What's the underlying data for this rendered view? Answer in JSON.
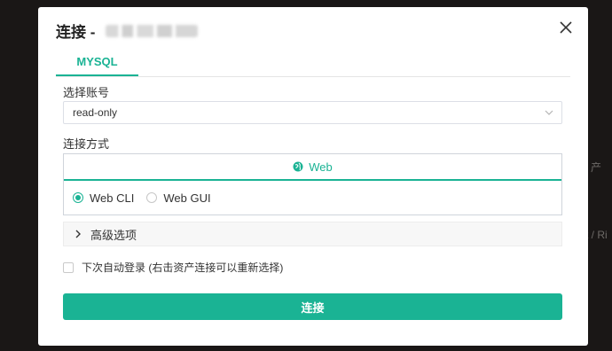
{
  "background": {
    "side_texts": [
      "产",
      "t / Ri"
    ]
  },
  "dialog": {
    "title": "连接 -",
    "close_label": "×",
    "tabs": [
      {
        "label": "MYSQL"
      }
    ],
    "account": {
      "label": "选择账号",
      "selected": "read-only"
    },
    "connect_method": {
      "label": "连接方式",
      "header": "Web",
      "options": [
        {
          "label": "Web CLI",
          "checked": true
        },
        {
          "label": "Web GUI",
          "checked": false
        }
      ]
    },
    "advanced_label": "高级选项",
    "remember_label": "下次自动登录 (右击资产连接可以重新选择)",
    "connect_button": "连接"
  },
  "colors": {
    "accent": "#1ab394",
    "backdrop": "#1a1716"
  }
}
